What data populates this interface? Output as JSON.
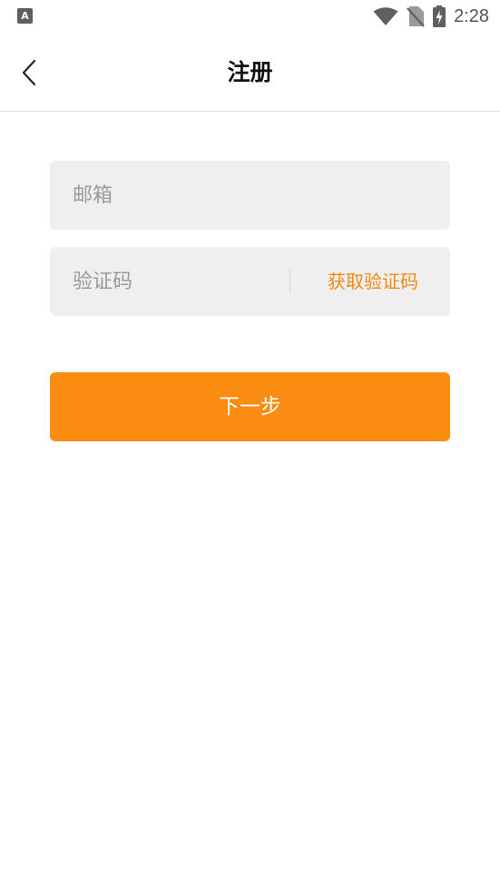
{
  "status_bar": {
    "time": "2:28",
    "left_icon": "A",
    "icons": [
      "wifi-icon",
      "no-sim-icon",
      "battery-charging-icon"
    ]
  },
  "header": {
    "title": "注册",
    "back_icon": "chevron-left-icon"
  },
  "form": {
    "email_placeholder": "邮箱",
    "code_placeholder": "验证码",
    "get_code_label": "获取验证码",
    "next_label": "下一步"
  },
  "colors": {
    "accent": "#fb8c12",
    "accent_text": "#f5880f",
    "field_bg": "#efefef",
    "placeholder": "#9a9a9a"
  }
}
